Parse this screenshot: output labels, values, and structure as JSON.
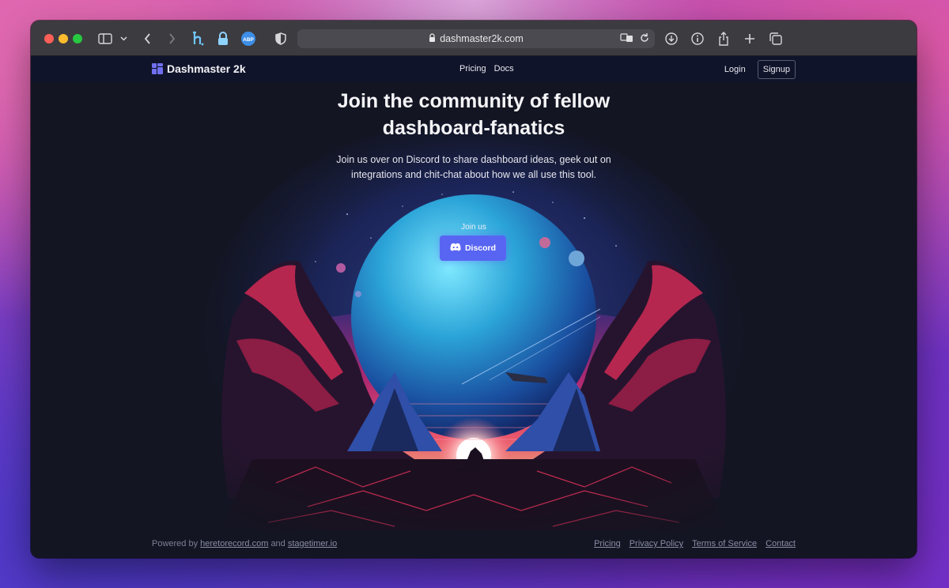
{
  "browser": {
    "url": "dashmaster2k.com",
    "icons": [
      "sidebar-icon",
      "chevron-down-icon",
      "back-icon",
      "forward-icon",
      "hypothesis-icon",
      "lock-extension-icon",
      "abp-icon",
      "shield-icon",
      "translate-icon",
      "reload-icon",
      "download-icon",
      "info-icon",
      "share-icon",
      "new-tab-icon",
      "tabs-overview-icon"
    ],
    "abp_label": "ABP"
  },
  "nav": {
    "brand": "Dashmaster 2k",
    "links": [
      "Pricing",
      "Docs"
    ],
    "login": "Login",
    "signup": "Signup"
  },
  "hero": {
    "title_line1": "Join the community of fellow",
    "title_line2": "dashboard-fanatics",
    "subtitle_line1": "Join us over on Discord to share dashboard ideas, geek out on",
    "subtitle_line2": "integrations and chit-chat about how we all use this tool.",
    "join_label": "Join us",
    "discord_label": "Discord"
  },
  "footer": {
    "powered_by": "Powered by",
    "link1": "heretorecord.com",
    "and": "and",
    "link2": "stagetimer.io",
    "links": [
      "Pricing",
      "Privacy Policy",
      "Terms of Service",
      "Contact"
    ]
  },
  "colors": {
    "accent": "#5865f2",
    "brand": "#6f6ff0",
    "background": "#131522"
  }
}
